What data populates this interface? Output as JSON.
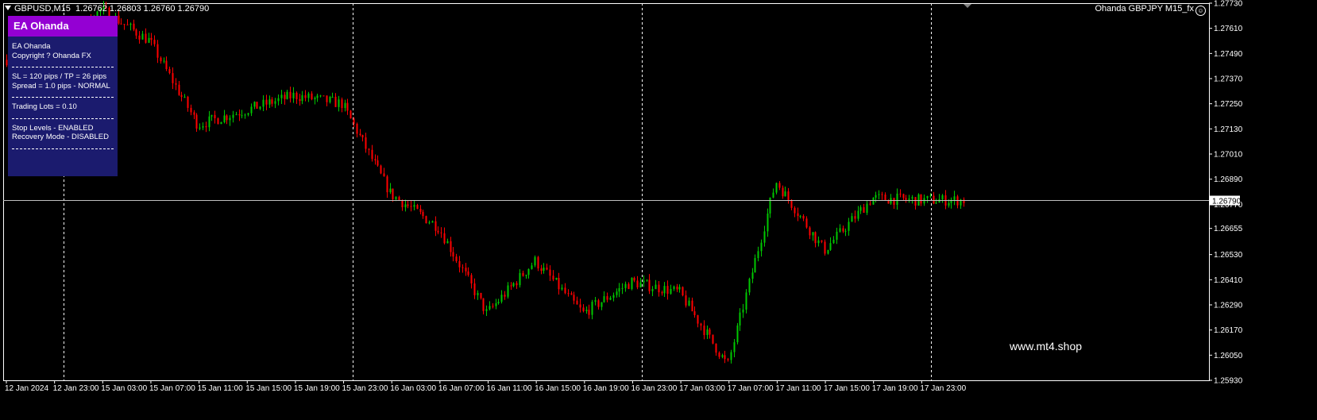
{
  "header": {
    "symbol_tf": "GBPUSD,M15",
    "ohlc": "1.26762 1.26803 1.26760 1.26790"
  },
  "ea_indicator": {
    "label": "Ohanda GBPJPY M15_fx",
    "icon": "smiley-icon"
  },
  "panel": {
    "title": "EA Ohanda",
    "name_line": "EA Ohanda",
    "copyright": "Copyright ? Ohanda FX",
    "sl_tp": "SL = 120 pips / TP = 26 pips",
    "spread": "Spread = 1.0 pips - NORMAL",
    "lots": "Trading Lots = 0.10",
    "stop_levels": "Stop Levels - ENABLED",
    "recovery": "Recovery Mode - DISABLED",
    "title_color": "#9400d3",
    "background_color": "#1b1b6e"
  },
  "watermark": "www.mt4.shop",
  "colors": {
    "background": "#000000",
    "bull": "#00c800",
    "bear": "#ff0000",
    "grid": "#ffffff",
    "axis_text": "#ffffff",
    "bid_line": "#c0c0c0",
    "bid_label_bg": "#ffffff",
    "bid_label_text": "#000000"
  },
  "chart_data": {
    "type": "candlestick",
    "symbol": "GBPUSD",
    "timeframe": "M15",
    "y_ticks": [
      1.2773,
      1.2761,
      1.2749,
      1.2737,
      1.2725,
      1.2713,
      1.2701,
      1.2689,
      1.2677,
      1.26655,
      1.2653,
      1.2641,
      1.2629,
      1.2617,
      1.2605,
      1.2593
    ],
    "y_range": [
      1.2593,
      1.2773
    ],
    "current_price": "1.26790",
    "x_labels": [
      "12 Jan 2024",
      "12 Jan 23:00",
      "15 Jan 03:00",
      "15 Jan 07:00",
      "15 Jan 11:00",
      "15 Jan 15:00",
      "15 Jan 19:00",
      "15 Jan 23:00",
      "16 Jan 03:00",
      "16 Jan 07:00",
      "16 Jan 11:00",
      "16 Jan 15:00",
      "16 Jan 19:00",
      "16 Jan 23:00",
      "17 Jan 03:00",
      "17 Jan 07:00",
      "17 Jan 11:00",
      "17 Jan 15:00",
      "17 Jan 19:00",
      "17 Jan 23:00"
    ],
    "day_separators_after_label": [
      "12 Jan 2024",
      "15 Jan 19:00",
      "16 Jan 19:00",
      "17 Jan 19:00"
    ],
    "close_path": [
      [
        "12 Jan 2024",
        1.2746
      ],
      [
        "12 Jan 23:00",
        1.275
      ],
      [
        "15 Jan 03:00",
        1.277
      ],
      [
        "15 Jan 07:00",
        1.2755
      ],
      [
        "15 Jan 11:00",
        1.2715
      ],
      [
        "15 Jan 15:00",
        1.2722
      ],
      [
        "15 Jan 19:00",
        1.2729
      ],
      [
        "15 Jan 23:00",
        1.2725
      ],
      [
        "16 Jan 03:00",
        1.2682
      ],
      [
        "16 Jan 07:00",
        1.2666
      ],
      [
        "16 Jan 11:00",
        1.2625
      ],
      [
        "16 Jan 15:00",
        1.265
      ],
      [
        "16 Jan 19:00",
        1.2625
      ],
      [
        "16 Jan 23:00",
        1.264
      ],
      [
        "17 Jan 03:00",
        1.2635
      ],
      [
        "17 Jan 07:00",
        1.26
      ],
      [
        "17 Jan 11:00",
        1.2688
      ],
      [
        "17 Jan 15:00",
        1.2655
      ],
      [
        "17 Jan 19:00",
        1.268
      ],
      [
        "17 Jan 23:00",
        1.2679
      ]
    ],
    "grid": false,
    "legend": "none"
  }
}
